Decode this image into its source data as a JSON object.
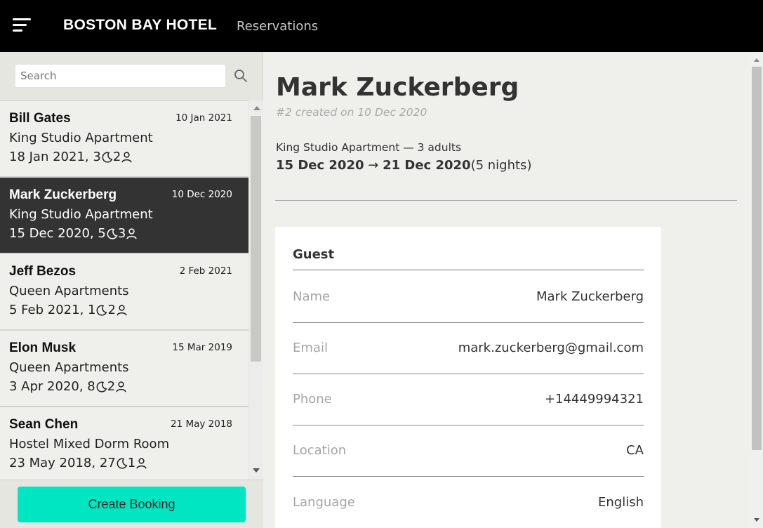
{
  "header": {
    "brand": "BOSTON BAY HOTEL",
    "section": "Reservations",
    "menu_icon": "hamburger-menu-icon"
  },
  "sidebar": {
    "search": {
      "placeholder": "Search",
      "value": "",
      "icon": "search-icon"
    },
    "bookings": [
      {
        "guest": "Bill Gates",
        "created": "10 Jan 2021",
        "room": "King Studio Apartment",
        "checkin": "18 Jan 2021, 3",
        "guests": "2",
        "selected": false
      },
      {
        "guest": "Mark Zuckerberg",
        "created": "10 Dec 2020",
        "room": "King Studio Apartment",
        "checkin": "15 Dec 2020, 5",
        "guests": "3",
        "selected": true
      },
      {
        "guest": "Jeff Bezos",
        "created": "2 Feb 2021",
        "room": "Queen Apartments",
        "checkin": "5 Feb 2021, 1",
        "guests": "2",
        "selected": false
      },
      {
        "guest": "Elon Musk",
        "created": "15 Mar 2019",
        "room": "Queen Apartments",
        "checkin": "3 Apr 2020, 8",
        "guests": "2",
        "selected": false
      },
      {
        "guest": "Sean Chen",
        "created": "21 May 2018",
        "room": "Hostel Mixed Dorm Room",
        "checkin": "23 May 2018, 27",
        "guests": "1",
        "selected": false
      }
    ],
    "create_button": "Create Booking"
  },
  "detail": {
    "title": "Mark Zuckerberg",
    "subtitle": "#2 created on 10 Dec 2020",
    "room_line": "King Studio Apartment — 3 adults",
    "start": "15 Dec 2020",
    "arrow": "→",
    "end": "21 Dec 2020",
    "nights": "(5 nights)",
    "guest_card": {
      "title": "Guest",
      "rows": [
        {
          "label": "Name",
          "value": "Mark Zuckerberg"
        },
        {
          "label": "Email",
          "value": "mark.zuckerberg@gmail.com"
        },
        {
          "label": "Phone",
          "value": "+14449994321"
        },
        {
          "label": "Location",
          "value": "CA"
        },
        {
          "label": "Language",
          "value": "English"
        }
      ]
    }
  },
  "colors": {
    "topbar": "#000000",
    "accent": "#00e6c3",
    "selected_item": "#333333",
    "background": "#efefeb"
  }
}
